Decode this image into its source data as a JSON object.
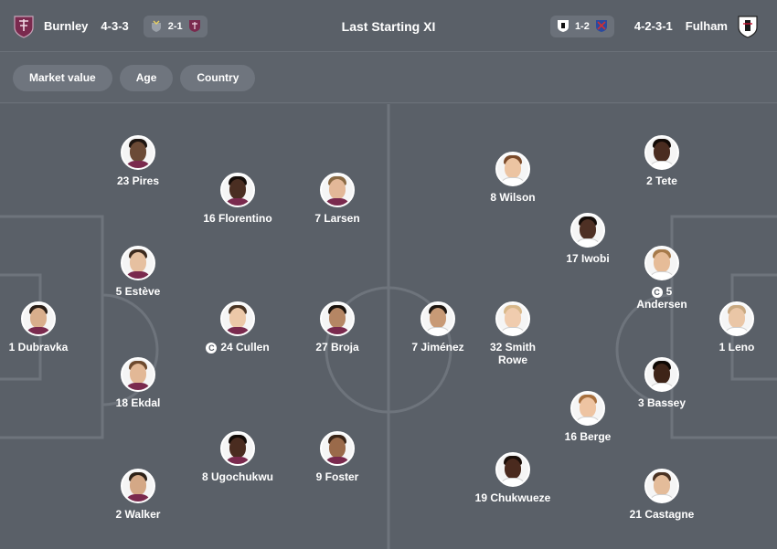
{
  "header": {
    "title": "Last Starting XI",
    "home": {
      "name": "Burnley",
      "formation": "4-3-3",
      "last_score": "2-1",
      "crest_color": "#7a2a4e"
    },
    "away": {
      "name": "Fulham",
      "formation": "4-2-3-1",
      "last_score": "1-2",
      "crest_color": "#ffffff"
    }
  },
  "filters": [
    "Market value",
    "Age",
    "Country"
  ],
  "home_players": [
    {
      "name": "23 Pires",
      "captain": false,
      "skin": "#6b4a36",
      "hair": "#1c1410"
    },
    {
      "name": "16 Florentino",
      "captain": false,
      "skin": "#4a2e22",
      "hair": "#140c08"
    },
    {
      "name": "7 Larsen",
      "captain": false,
      "skin": "#e3b898",
      "hair": "#8a6a44"
    },
    {
      "name": "5 Estève",
      "captain": false,
      "skin": "#e6c0a0",
      "hair": "#3c2a1e"
    },
    {
      "name": "1 Dubravka",
      "captain": false,
      "skin": "#d9ae8c",
      "hair": "#2a1e16"
    },
    {
      "name": "24 Cullen",
      "captain": true,
      "skin": "#ecc8a8",
      "hair": "#4a3524"
    },
    {
      "name": "27 Broja",
      "captain": false,
      "skin": "#b58664",
      "hair": "#1a120c"
    },
    {
      "name": "18 Ekdal",
      "captain": false,
      "skin": "#e2b896",
      "hair": "#6e4a2e"
    },
    {
      "name": "8 Ugochukwu",
      "captain": false,
      "skin": "#4a2c20",
      "hair": "#120a06"
    },
    {
      "name": "9 Foster",
      "captain": false,
      "skin": "#9a6a4a",
      "hair": "#3a2416"
    },
    {
      "name": "2 Walker",
      "captain": false,
      "skin": "#d4a886",
      "hair": "#2e2218"
    }
  ],
  "away_players": [
    {
      "name": "8 Wilson",
      "captain": false,
      "skin": "#ecc4a2",
      "hair": "#7a4a2a"
    },
    {
      "name": "2 Tete",
      "captain": false,
      "skin": "#4a2c20",
      "hair": "#120a06"
    },
    {
      "name": "17 Iwobi",
      "captain": false,
      "skin": "#4e3024",
      "hair": "#140c08"
    },
    {
      "name": "5 Andersen",
      "captain": true,
      "skin": "#e6bc98",
      "hair": "#a67a4a"
    },
    {
      "name": "7 Jiménez",
      "captain": false,
      "skin": "#c89a76",
      "hair": "#1e1610"
    },
    {
      "name": "32 Smith Rowe",
      "captain": false,
      "skin": "#f0ccae",
      "hair": "#d8b88a"
    },
    {
      "name": "1 Leno",
      "captain": false,
      "skin": "#eac6a6",
      "hair": "#c8a880"
    },
    {
      "name": "3 Bassey",
      "captain": false,
      "skin": "#3e2418",
      "hair": "#0e0804"
    },
    {
      "name": "16 Berge",
      "captain": false,
      "skin": "#eec4a2",
      "hair": "#a8703e"
    },
    {
      "name": "19 Chukwueze",
      "captain": false,
      "skin": "#4a2a1e",
      "hair": "#1a0e08"
    },
    {
      "name": "21 Castagne",
      "captain": false,
      "skin": "#e4bc9a",
      "hair": "#4a3222"
    }
  ],
  "colors": {
    "background": "#5d636b",
    "chip": "#6f757e",
    "pitch_line": "#6e747c"
  },
  "icons": {
    "captain": "captain-badge-icon",
    "home_crest": "burnley-crest-icon",
    "away_crest": "fulham-crest-icon"
  }
}
